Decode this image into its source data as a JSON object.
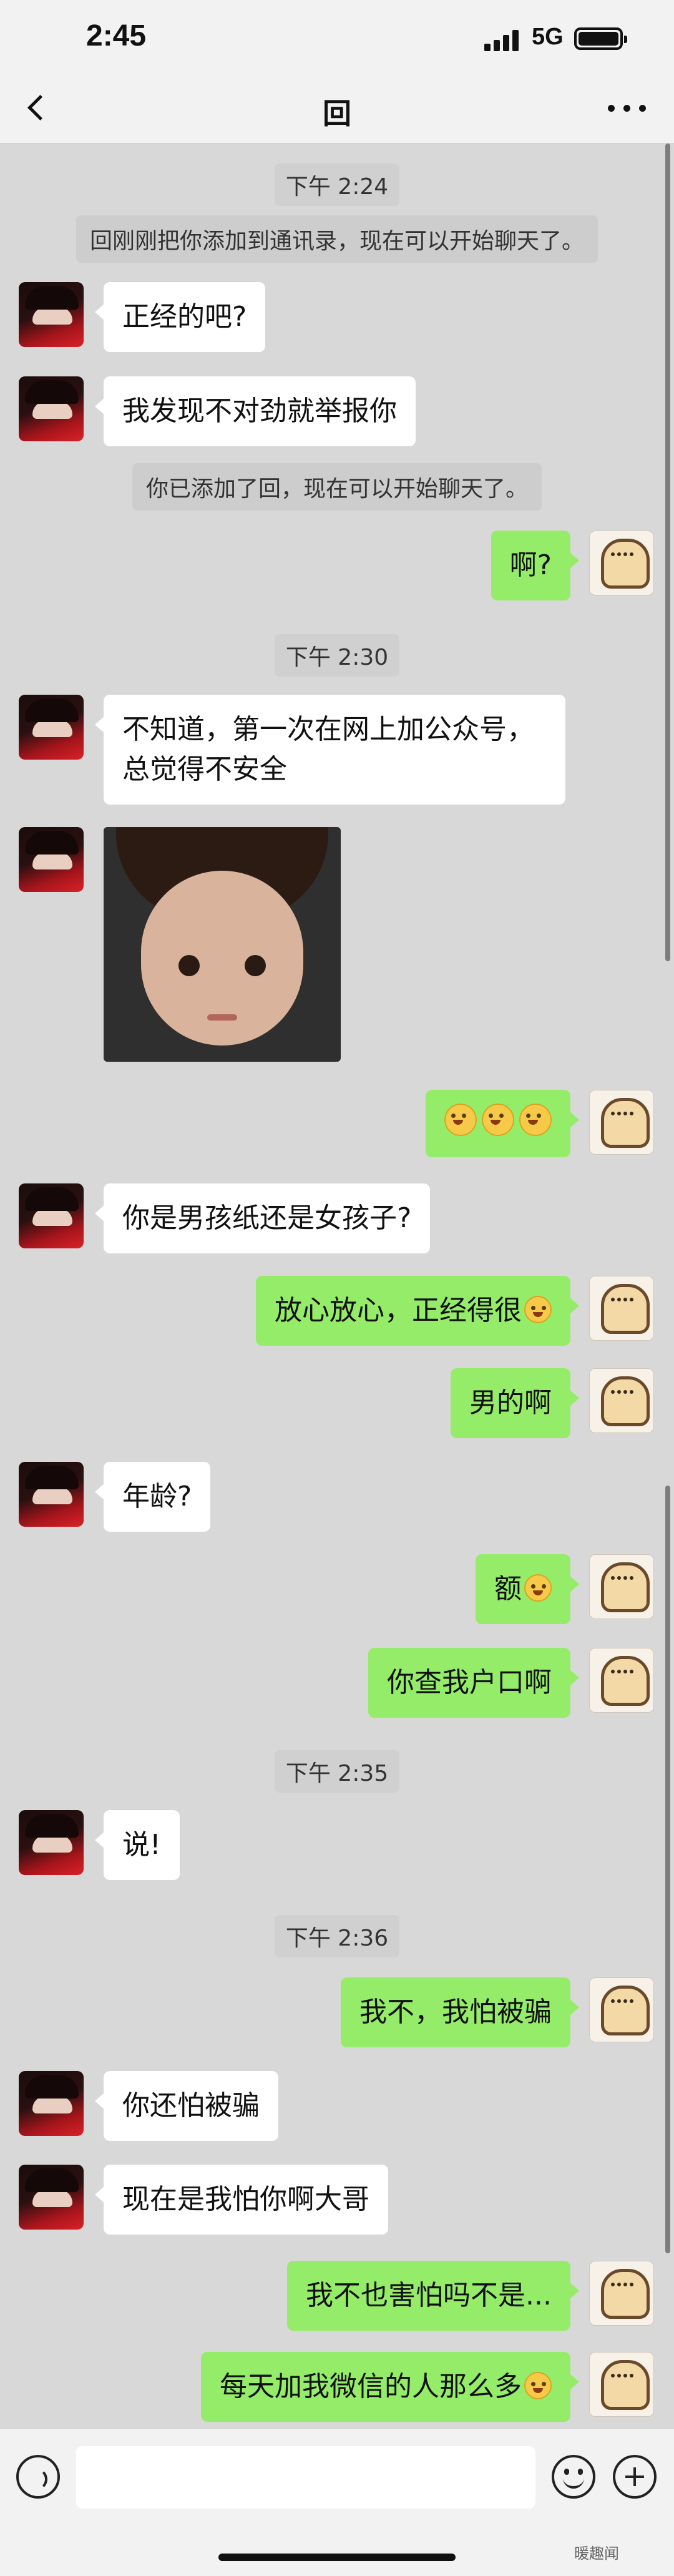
{
  "status_bar": {
    "time": "2:45",
    "network": "5G"
  },
  "nav": {
    "title": "回",
    "back_icon": "chevron-left-icon",
    "more_icon": "more-dots-icon"
  },
  "timestamps": [
    "下午 2:24",
    "下午 2:30",
    "下午 2:35",
    "下午 2:36"
  ],
  "system_messages": [
    "回刚刚把你添加到通讯录，现在可以开始聊天了。",
    "你已添加了回，现在可以开始聊天了。"
  ],
  "messages": [
    {
      "side": "left",
      "text": "正经的吧?"
    },
    {
      "side": "left",
      "text": "我发现不对劲就举报你"
    },
    {
      "side": "right",
      "text": "啊?"
    },
    {
      "side": "left",
      "text": "不知道，第一次在网上加公众号，总觉得不安全"
    },
    {
      "side": "left",
      "type": "image",
      "text": ""
    },
    {
      "side": "right",
      "type": "emoji",
      "text": "",
      "emoji_count": 3,
      "emoji": "laughing-tears-emoji"
    },
    {
      "side": "left",
      "text": "你是男孩纸还是女孩子?"
    },
    {
      "side": "right",
      "text": "放心放心，正经得很",
      "emoji": "smirk-emoji"
    },
    {
      "side": "right",
      "text": "男的啊"
    },
    {
      "side": "left",
      "text": "年龄?"
    },
    {
      "side": "right",
      "text": "额",
      "emoji": "sweat-emoji"
    },
    {
      "side": "right",
      "text": "你查我户口啊"
    },
    {
      "side": "left",
      "text": "说!"
    },
    {
      "side": "right",
      "text": "我不，我怕被骗"
    },
    {
      "side": "left",
      "text": "你还怕被骗"
    },
    {
      "side": "left",
      "text": "现在是我怕你啊大哥"
    },
    {
      "side": "right",
      "text": "我不也害怕吗不是..."
    },
    {
      "side": "right",
      "text": "每天加我微信的人那么多",
      "emoji": "sneer-emoji"
    }
  ],
  "input_bar": {
    "placeholder": "",
    "voice_icon": "voice-icon",
    "emoji_icon": "emoji-icon",
    "plus_icon": "plus-icon"
  },
  "watermark": "暖趣闻"
}
